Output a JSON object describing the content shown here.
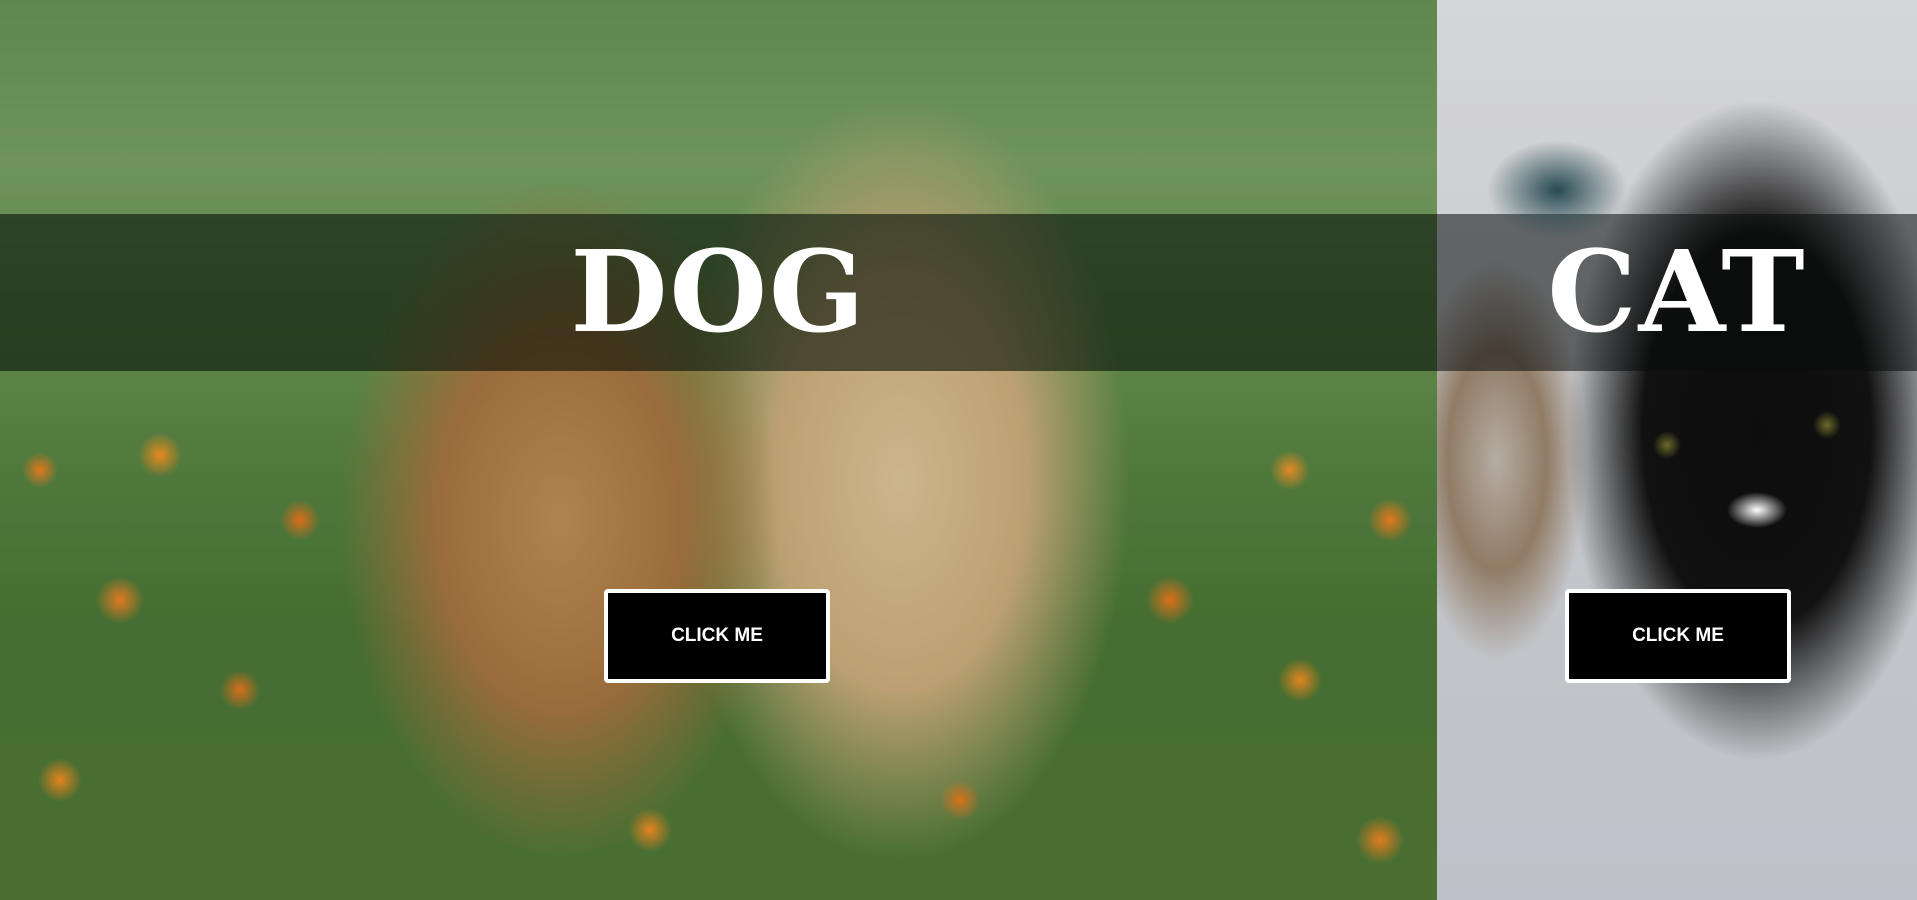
{
  "dog": {
    "title": "DOG",
    "button_label": "CLICK ME"
  },
  "cat": {
    "title": "CAT",
    "button_label": "CLICK ME"
  },
  "colors": {
    "band": "#0a140a",
    "button_bg": "#000000",
    "button_border": "#ffffff",
    "title_text": "#ffffff"
  }
}
